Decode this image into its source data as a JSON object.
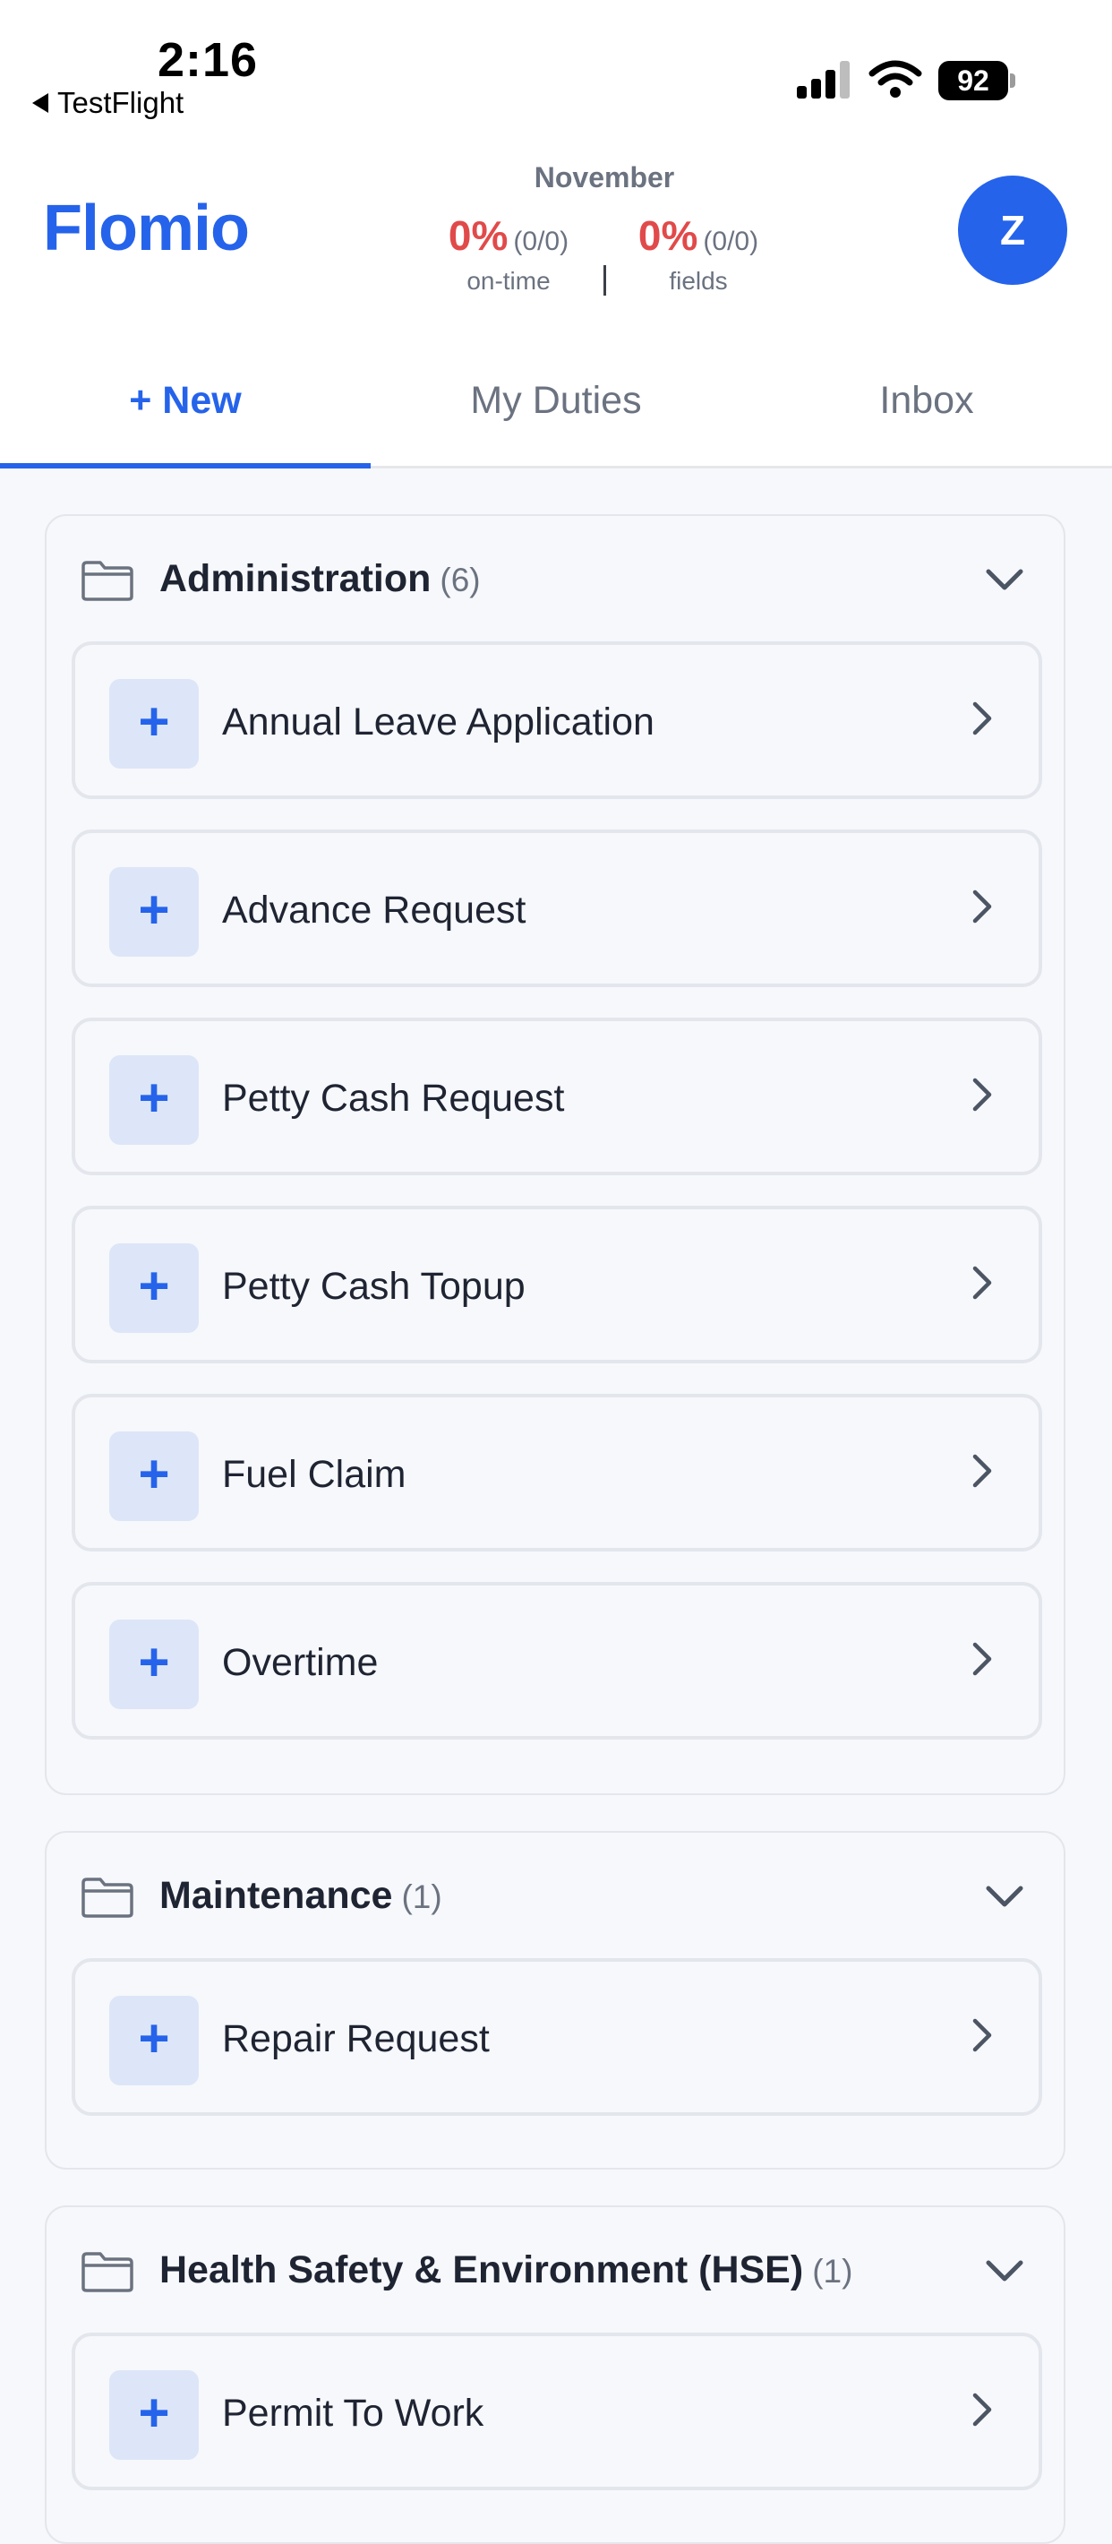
{
  "status_bar": {
    "time": "2:16",
    "back_label": "TestFlight",
    "battery": "92"
  },
  "header": {
    "app_name": "Flomio",
    "month": "November",
    "stats": [
      {
        "percent": "0%",
        "count": "(0/0)",
        "label": "on-time"
      },
      {
        "percent": "0%",
        "count": "(0/0)",
        "label": "fields"
      }
    ],
    "avatar_initial": "Z"
  },
  "tabs": [
    {
      "label": "+ New",
      "active": true
    },
    {
      "label": "My Duties",
      "active": false
    },
    {
      "label": "Inbox",
      "active": false
    }
  ],
  "sections": [
    {
      "title": "Administration",
      "count": "(6)",
      "items": [
        {
          "label": "Annual Leave Application"
        },
        {
          "label": "Advance Request"
        },
        {
          "label": "Petty Cash Request"
        },
        {
          "label": "Petty Cash Topup"
        },
        {
          "label": "Fuel Claim"
        },
        {
          "label": "Overtime"
        }
      ]
    },
    {
      "title": "Maintenance",
      "count": "(1)",
      "items": [
        {
          "label": "Repair Request"
        }
      ]
    },
    {
      "title": "Health Safety & Environment (HSE)",
      "count": "(1)",
      "items": [
        {
          "label": "Permit To Work"
        }
      ]
    }
  ],
  "icons": {
    "plus": "+",
    "chevron_right": "chevron-right-icon",
    "chevron_down": "chevron-down-icon",
    "folder": "folder-icon"
  },
  "colors": {
    "accent": "#2563eb",
    "stat_red": "#e14a4a",
    "plus_bg": "#dde6f8",
    "page_bg": "#f7f8fb",
    "border": "#e3e6ec"
  }
}
